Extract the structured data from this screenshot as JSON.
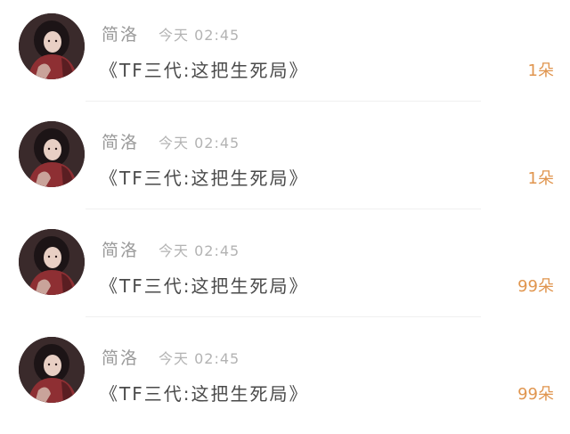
{
  "messages": [
    {
      "name": "简洛",
      "time": "今天 02:45",
      "title": "《TF三代:这把生死局》",
      "gift": "1朵"
    },
    {
      "name": "简洛",
      "time": "今天 02:45",
      "title": "《TF三代:这把生死局》",
      "gift": "1朵"
    },
    {
      "name": "简洛",
      "time": "今天 02:45",
      "title": "《TF三代:这把生死局》",
      "gift": "99朵"
    },
    {
      "name": "简洛",
      "time": "今天 02:45",
      "title": "《TF三代:这把生死局》",
      "gift": "99朵"
    }
  ],
  "colors": {
    "gift": "#e0954e",
    "name": "#9a9a9a",
    "time": "#b3b3b3",
    "title": "#4a4a4a"
  }
}
